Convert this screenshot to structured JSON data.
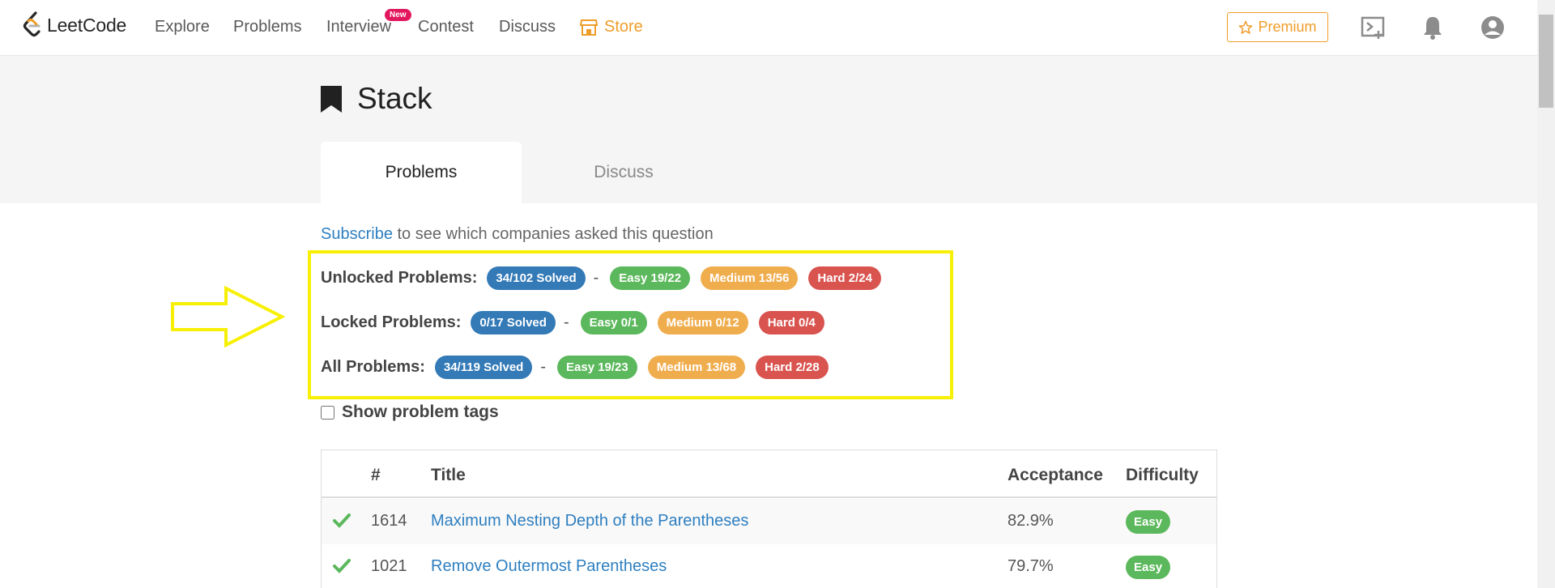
{
  "nav": {
    "logo_text": "LeetCode",
    "items": [
      "Explore",
      "Problems",
      "Interview",
      "Contest",
      "Discuss"
    ],
    "new_badge": "New",
    "store": "Store",
    "premium": "Premium",
    "accent_color": "#ef9d29"
  },
  "header": {
    "title": "Stack",
    "tabs": [
      "Problems",
      "Discuss"
    ]
  },
  "subscribe": {
    "link": "Subscribe",
    "text": " to see which companies asked this question"
  },
  "stats": {
    "unlocked": {
      "label": "Unlocked Problems:",
      "solved": "34/102 Solved",
      "easy": "Easy 19/22",
      "medium": "Medium 13/56",
      "hard": "Hard 2/24"
    },
    "locked": {
      "label": "Locked Problems:",
      "solved": "0/17 Solved",
      "easy": "Easy 0/1",
      "medium": "Medium 0/12",
      "hard": "Hard 0/4"
    },
    "all": {
      "label": "All Problems:",
      "solved": "34/119 Solved",
      "easy": "Easy 19/23",
      "medium": "Medium 13/68",
      "hard": "Hard 2/28"
    },
    "dash": "-"
  },
  "show_tags": "Show problem tags",
  "table": {
    "headers": {
      "num": "#",
      "title": "Title",
      "acceptance": "Acceptance",
      "difficulty": "Difficulty"
    },
    "rows": [
      {
        "num": "1614",
        "title": "Maximum Nesting Depth of the Parentheses",
        "acceptance": "82.9%",
        "difficulty": "Easy"
      },
      {
        "num": "1021",
        "title": "Remove Outermost Parentheses",
        "acceptance": "79.7%",
        "difficulty": "Easy"
      }
    ]
  },
  "icons": [
    "leetcode-logo-icon",
    "store-icon",
    "star-icon",
    "playground-icon",
    "bell-icon",
    "user-icon",
    "bookmark-icon",
    "check-icon",
    "arrow-icon"
  ]
}
